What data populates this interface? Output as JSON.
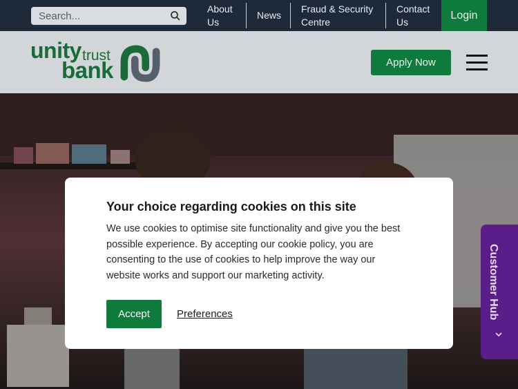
{
  "search": {
    "placeholder": "Search..."
  },
  "top_nav": {
    "items": [
      {
        "line1": "About",
        "line2": "Us"
      },
      {
        "line1": "News",
        "line2": ""
      },
      {
        "line1": "Fraud & Security",
        "line2": "Centre"
      },
      {
        "line1": "Contact",
        "line2": "Us"
      }
    ],
    "login_label": "Login"
  },
  "header": {
    "logo": {
      "word1": "unity",
      "word2": "trust",
      "word3": "bank"
    },
    "apply_label": "Apply Now"
  },
  "side_tab": {
    "label": "Customer Hub",
    "chevron": "›"
  },
  "cookie_modal": {
    "title": "Your choice regarding cookies on this site",
    "body": "We use cookies to optimise site functionality and give you the best possible experience. By accepting our cookie policy, you are consenting to the use of cookies to help improve the way our website works and support our marketing activity.",
    "accept_label": "Accept",
    "preferences_label": "Preferences"
  },
  "colors": {
    "topbar": "#1e2a3a",
    "brand_green": "#0e7a3c",
    "header_bg": "#d3d6d9",
    "hub_purple": "#5a1d8a"
  }
}
